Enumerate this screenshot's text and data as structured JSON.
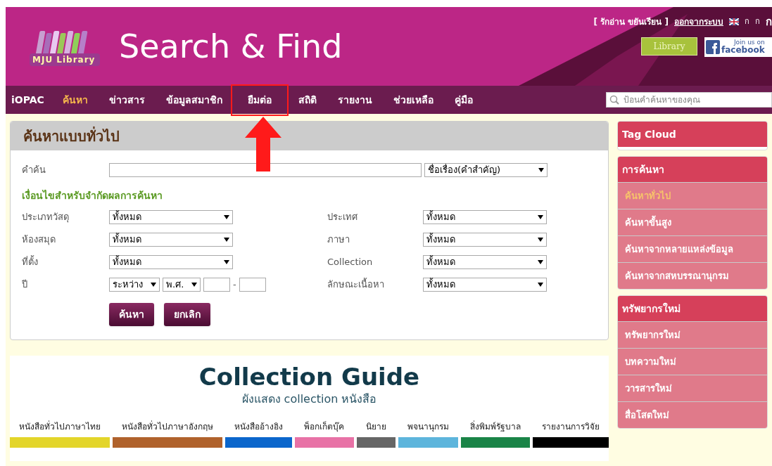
{
  "header": {
    "logo_text": "MJU Library",
    "title": "Search & Find",
    "user": "[ รักอ่าน ขยันเรียน ]",
    "logout": "ออกจากระบบ",
    "lang_small": [
      "ก",
      "ก"
    ],
    "lang_big": "ก",
    "badges": [
      {
        "kind": "library",
        "text": "Library"
      },
      {
        "kind": "facebook",
        "text": "facebook",
        "note": "Join us on"
      }
    ]
  },
  "nav": {
    "brand": "iOPAC",
    "items": [
      {
        "label": "ค้นหา",
        "selected": true,
        "annotated": false
      },
      {
        "label": "ข่าวสาร",
        "selected": false,
        "annotated": false
      },
      {
        "label": "ข้อมูลสมาชิก",
        "selected": false,
        "annotated": false
      },
      {
        "label": "ยืมต่อ",
        "selected": false,
        "annotated": true
      },
      {
        "label": "สถิติ",
        "selected": false,
        "annotated": false
      },
      {
        "label": "รายงาน",
        "selected": false,
        "annotated": false
      },
      {
        "label": "ช่วยเหลือ",
        "selected": false,
        "annotated": false
      },
      {
        "label": "คู่มือ",
        "selected": false,
        "annotated": false
      }
    ],
    "search_placeholder": "ป้อนคำค้นหาของคุณ"
  },
  "search_panel": {
    "title": "ค้นหาแบบทั่วไป",
    "keyword_label": "คำค้น",
    "keyword_field": "ชื่อเรื่อง(คำสำคัญ)",
    "conditions_title": "เงื่อนไขสำหรับจำกัดผลการค้นหา",
    "left": [
      {
        "label": "ประเภทวัสดุ",
        "value": "ทั้งหมด"
      },
      {
        "label": "ห้องสมุด",
        "value": "ทั้งหมด"
      },
      {
        "label": "ที่ตั้ง",
        "value": "ทั้งหมด"
      }
    ],
    "year": {
      "label": "ปี",
      "range": "ระหว่าง",
      "era": "พ.ศ.",
      "separator": "-"
    },
    "right": [
      {
        "label": "ประเทศ",
        "value": "ทั้งหมด"
      },
      {
        "label": "ภาษา",
        "value": "ทั้งหมด"
      },
      {
        "label": "Collection",
        "value": "ทั้งหมด"
      },
      {
        "label": "ลักษณะเนื้อหา",
        "value": "ทั้งหมด"
      }
    ],
    "buttons": [
      "ค้นหา",
      "ยกเลิก"
    ]
  },
  "collection_guide": {
    "title": "Collection Guide",
    "subtitle": "ผังแสดง collection หนังสือ",
    "categories": [
      {
        "label": "หนังสือทั่วไปภาษาไทย",
        "color": "#e3d52a"
      },
      {
        "label": "หนังสือทั่วไปภาษาอังกฤษ",
        "color": "#b0622c"
      },
      {
        "label": "หนังสืออ้างอิง",
        "color": "#0b66cc"
      },
      {
        "label": "พ็อกเก็ตบุ๊ค",
        "color": "#e872a6"
      },
      {
        "label": "นิยาย",
        "color": "#666666"
      },
      {
        "label": "พจนานุกรม",
        "color": "#5db5dc"
      },
      {
        "label": "สิ่งพิมพ์รัฐบาล",
        "color": "#1a8447"
      },
      {
        "label": "รายงานการวิจัย",
        "color": "#000000"
      }
    ]
  },
  "sidebar": [
    {
      "title": "Tag Cloud"
    },
    {
      "title": "การค้นหา",
      "items": [
        {
          "label": "ค้นหาทั่วไป",
          "selected": true
        },
        {
          "label": "ค้นหาขั้นสูง",
          "selected": false
        },
        {
          "label": "ค้นหาจากหลายแหล่งข้อมูล",
          "selected": false
        },
        {
          "label": "ค้นหาจากสหบรรณานุกรม",
          "selected": false
        }
      ]
    },
    {
      "title": "ทรัพยากรใหม่",
      "items": [
        {
          "label": "ทรัพยากรใหม่",
          "selected": false
        },
        {
          "label": "บทความใหม่",
          "selected": false
        },
        {
          "label": "วารสารใหม่",
          "selected": false
        },
        {
          "label": "สื่อโสตใหม่",
          "selected": false
        }
      ]
    }
  ]
}
